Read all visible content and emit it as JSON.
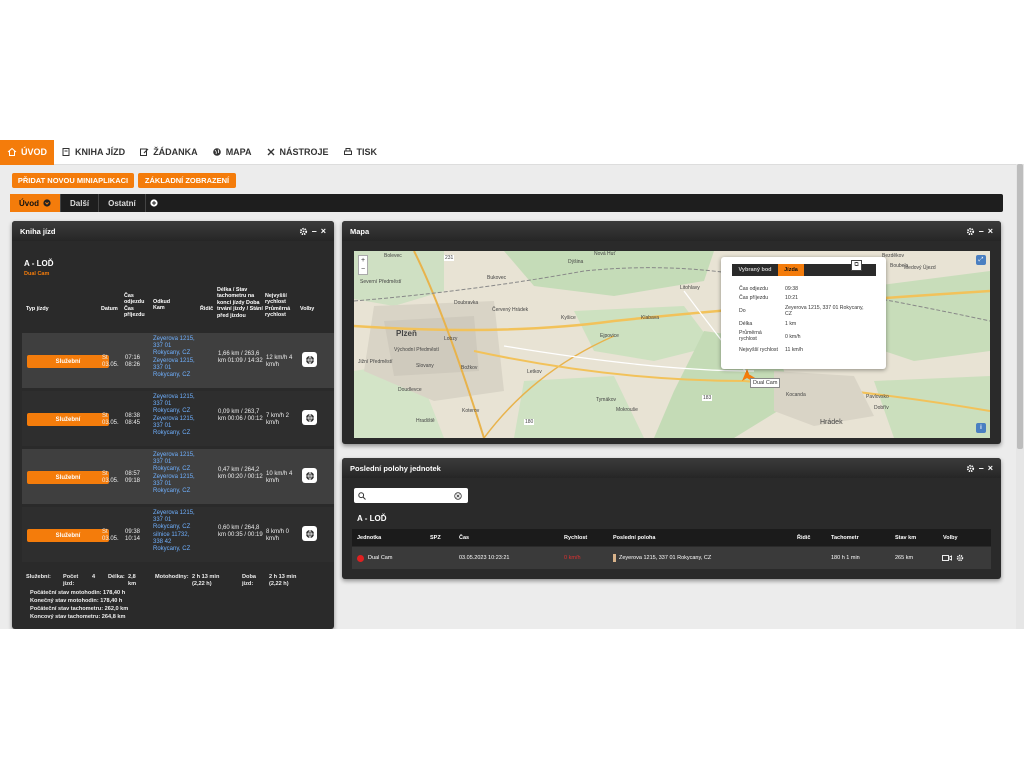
{
  "nav": {
    "items": [
      {
        "label": "ÚVOD",
        "icon": "home-icon"
      },
      {
        "label": "KNIHA JÍZD",
        "icon": "book-icon"
      },
      {
        "label": "ŽÁDANKA",
        "icon": "edit-icon"
      },
      {
        "label": "MAPA",
        "icon": "globe-icon"
      },
      {
        "label": "NÁSTROJE",
        "icon": "tools-icon"
      },
      {
        "label": "TISK",
        "icon": "print-icon"
      }
    ]
  },
  "buttons": {
    "add_app": "PŘIDAT NOVOU MINIAPLIKACI",
    "basic_view": "ZÁKLADNÍ ZOBRAZENÍ"
  },
  "tabs": [
    "Úvod",
    "Další",
    "Ostatní"
  ],
  "colors": {
    "accent": "#f47c0b",
    "panel": "#2a2a2a",
    "link": "#6fb0ff",
    "speed_red": "#e03030"
  },
  "kniha": {
    "title": "Kniha jízd",
    "vehicle": "A - LOĎ",
    "unit": "Dual Cam",
    "headers": {
      "typ": "Typ jízdy",
      "datum": "Datum",
      "cas": "Čas odjezdu Čas příjezdu",
      "odkud": "Odkud Kam",
      "ridic": "Řidič",
      "delka": "Délka / Stav tachometru na konci jízdy Doba trvání jízdy / Stání před jízdou",
      "rychlost": "Nejvyšší rychlost Průměrná rychlost",
      "volby": "Volby"
    },
    "rows": [
      {
        "typ": "Služební",
        "datum": "St 03.05.",
        "cas": "07:16 08:26",
        "odkud": "Zeyerova 1215, 337 01 Rokycany, CZ Zeyerova 1215, 337 01 Rokycany, CZ",
        "delka": "1,66 km / 263,6 km 01:09 / 14:32",
        "rychlost": "12 km/h 4 km/h"
      },
      {
        "typ": "Služební",
        "datum": "St 03.05.",
        "cas": "08:38 08:45",
        "odkud": "Zeyerova 1215, 337 01 Rokycany, CZ Zeyerova 1215, 337 01 Rokycany, CZ",
        "delka": "0,09 km / 263,7 km 00:06 / 00:12",
        "rychlost": "7 km/h 2 km/h"
      },
      {
        "typ": "Služební",
        "datum": "St 03.05.",
        "cas": "08:57 09:18",
        "odkud": "Zeyerova 1215, 337 01 Rokycany, CZ Zeyerova 1215, 337 01 Rokycany, CZ",
        "delka": "0,47 km / 264,2 km 00:20 / 00:12",
        "rychlost": "10 km/h 4 km/h"
      },
      {
        "typ": "Služební",
        "datum": "St 03.05.",
        "cas": "09:38 10:14",
        "odkud": "Zeyerova 1215, 337 01 Rokycany, CZ silnice 11732, 338 42 Rokycany, CZ",
        "delka": "0,60 km / 264,8 km 00:35 / 00:19",
        "rychlost": "8 km/h 0 km/h"
      }
    ],
    "summary": {
      "sluzebni": "Služební:",
      "pocet_label": "Počet jízd:",
      "pocet": "4",
      "delka_label": "Délka:",
      "delka": "2,8 km",
      "moto_label": "Motohodiny:",
      "moto": "2 h 13 min (2,22 h)",
      "doba_label": "Doba jízd:",
      "doba": "2 h 13 min (2,22 h)",
      "lines": [
        "Počáteční stav motohodin: 178,40 h",
        "Konečný stav motohodin: 178,40 h",
        "Počáteční stav tachometru: 262,0 km",
        "Koncový stav tachometru: 264,8 km"
      ]
    }
  },
  "mapa": {
    "title": "Mapa",
    "popup": {
      "tab1": "Vybraný bod",
      "tab2": "Jízda",
      "rows": [
        {
          "k": "Čas odjezdu",
          "v": "09:38"
        },
        {
          "k": "Čas příjezdu",
          "v": "10:21"
        },
        {
          "k": "Do",
          "v": "Zeyerova 1215, 337 01 Rokycany, CZ"
        },
        {
          "k": "Délka",
          "v": "1 km"
        },
        {
          "k": "Průměrná rychlost",
          "v": "0 km/h"
        },
        {
          "k": "Nejvyšší rychlost",
          "v": "11 km/h"
        }
      ]
    },
    "marker": "Dual Cam",
    "labels": [
      "Bolevec",
      "Severní Předměstí",
      "Bukovec",
      "Doubravka",
      "Červený Hrádek",
      "Plzeň",
      "Lobzy",
      "Východní Předměstí",
      "Jižní Předměstí",
      "Slovany",
      "Božkov",
      "Doudlevce",
      "Letkov",
      "Kyšice",
      "Ejpovice",
      "Klabava",
      "Tymákov",
      "Mokrouše",
      "Koterov",
      "Hradiště",
      "Kocanda",
      "Hrádek",
      "Pavlovsko",
      "Dobřív",
      "Litohlavy",
      "Dýšina",
      "Nová Huť",
      "Bezděkov",
      "Boubelc",
      "Medový Újezd",
      "231",
      "183",
      "180"
    ]
  },
  "polohy": {
    "title": "Poslední polohy jednotek",
    "search_placeholder": "",
    "vehicle": "A - LOĎ",
    "headers": [
      "Jednotka",
      "SPZ",
      "Čas",
      "Rychlost",
      "Poslední poloha",
      "Řidič",
      "Tachometr",
      "Stav km",
      "Volby"
    ],
    "row": {
      "jednotka": "Dual Cam",
      "spz": "",
      "cas": "03.05.2023 10:23:21",
      "rychlost": "0 km/h",
      "poloha": "Zeyerova 1215, 337 01 Rokycany, CZ",
      "ridic": "",
      "tachometr": "180 h 1 min",
      "stavkm": "265 km"
    }
  }
}
